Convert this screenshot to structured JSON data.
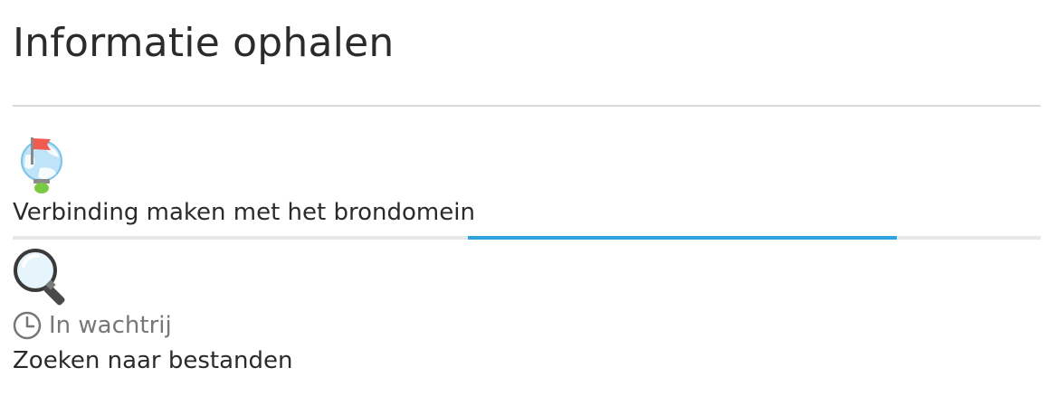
{
  "page": {
    "title": "Informatie ophalen"
  },
  "steps": [
    {
      "icon": "globe-flag-icon",
      "label": "Verbinding maken met het brondomein",
      "progress_fraction_start": 0.443,
      "progress_fraction_end": 0.86,
      "progress_state": "indeterminate"
    },
    {
      "icon": "magnifier-icon",
      "status": "In wachtrij",
      "status_icon": "clock-icon",
      "label": "Zoeken naar bestanden"
    }
  ],
  "colors": {
    "accent": "#2ea3dd",
    "divider": "#d9d9d9",
    "track": "#e8e8e8",
    "status_text": "#777777"
  }
}
